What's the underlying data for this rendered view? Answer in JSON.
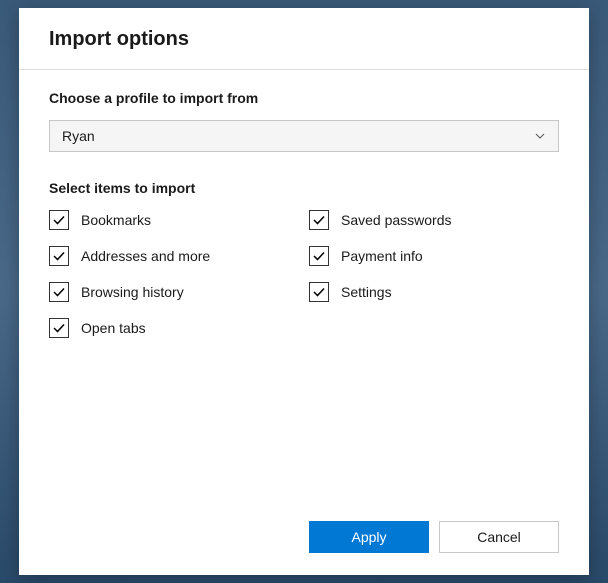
{
  "dialog": {
    "title": "Import options",
    "profile_label": "Choose a profile to import from",
    "profile_selected": "Ryan",
    "items_label": "Select items to import",
    "checkboxes": {
      "bookmarks": "Bookmarks",
      "saved_passwords": "Saved passwords",
      "addresses": "Addresses and more",
      "payment_info": "Payment info",
      "browsing_history": "Browsing history",
      "settings": "Settings",
      "open_tabs": "Open tabs"
    },
    "apply_label": "Apply",
    "cancel_label": "Cancel"
  }
}
